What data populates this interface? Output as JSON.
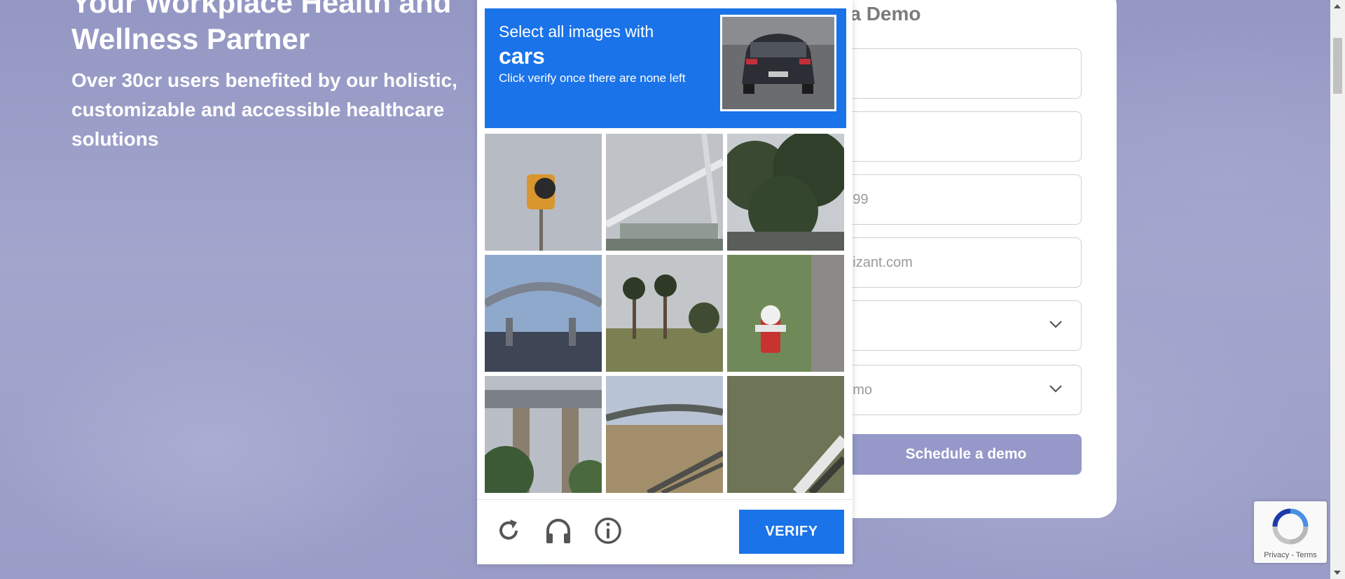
{
  "hero": {
    "title": "Your Workplace Health and Wellness Partner",
    "subtitle": "Over 30cr users benefited by our holistic, customizable and accessible healthcare solutions"
  },
  "form": {
    "heading": "e a Demo",
    "fields": [
      {
        "value": ""
      },
      {
        "value": "t"
      },
      {
        "value": "9999"
      },
      {
        "value": "gnizant.com"
      },
      {
        "value": ")"
      },
      {
        "value": "demo"
      }
    ],
    "submit_label": "Schedule a demo"
  },
  "captcha": {
    "instruction": "Select all images with",
    "keyword": "cars",
    "hint": "Click verify once there are none left",
    "verify_label": "VERIFY",
    "tiles": [
      "traffic light",
      "overpass",
      "trees",
      "bridge",
      "palm trees",
      "fire hydrant",
      "overpass",
      "highway",
      "grass"
    ]
  },
  "recaptcha_badge": {
    "privacy": "Privacy",
    "separator": " - ",
    "terms": "Terms"
  },
  "colors": {
    "captcha_blue": "#1a73e8",
    "submit": "#9598c8",
    "background": "#9da0c8"
  }
}
